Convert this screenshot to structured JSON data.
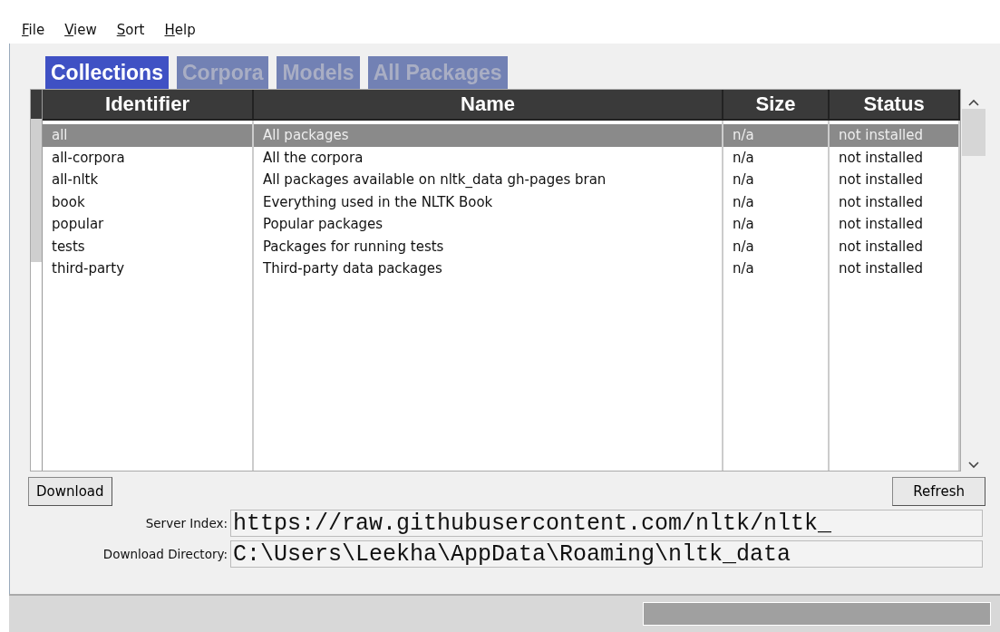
{
  "menu": [
    "File",
    "View",
    "Sort",
    "Help"
  ],
  "tabs": [
    {
      "label": "Collections",
      "selected": true
    },
    {
      "label": "Corpora",
      "selected": false
    },
    {
      "label": "Models",
      "selected": false
    },
    {
      "label": "All Packages",
      "selected": false
    }
  ],
  "table": {
    "columns": [
      "Identifier",
      "Name",
      "Size",
      "Status"
    ],
    "rows": [
      {
        "cells": [
          "all",
          "All packages",
          "n/a",
          "not installed"
        ],
        "selected": true
      },
      {
        "cells": [
          "all-corpora",
          "All the corpora",
          "n/a",
          "not installed"
        ],
        "selected": false
      },
      {
        "cells": [
          "all-nltk",
          "All packages available on nltk_data gh-pages bran",
          "n/a",
          "not installed"
        ],
        "selected": false
      },
      {
        "cells": [
          "book",
          "Everything used in the NLTK Book",
          "n/a",
          "not installed"
        ],
        "selected": false
      },
      {
        "cells": [
          "popular",
          "Popular packages",
          "n/a",
          "not installed"
        ],
        "selected": false
      },
      {
        "cells": [
          "tests",
          "Packages for running tests",
          "n/a",
          "not installed"
        ],
        "selected": false
      },
      {
        "cells": [
          "third-party",
          "Third-party data packages",
          "n/a",
          "not installed"
        ],
        "selected": false
      }
    ]
  },
  "buttons": {
    "download": "Download",
    "refresh": "Refresh"
  },
  "fields": [
    {
      "label": "Server Index:",
      "value": "https://raw.githubusercontent.com/nltk/nltk_"
    },
    {
      "label": "Download Directory:",
      "value": "C:\\Users\\Leekha\\AppData\\Roaming\\nltk_data"
    }
  ]
}
